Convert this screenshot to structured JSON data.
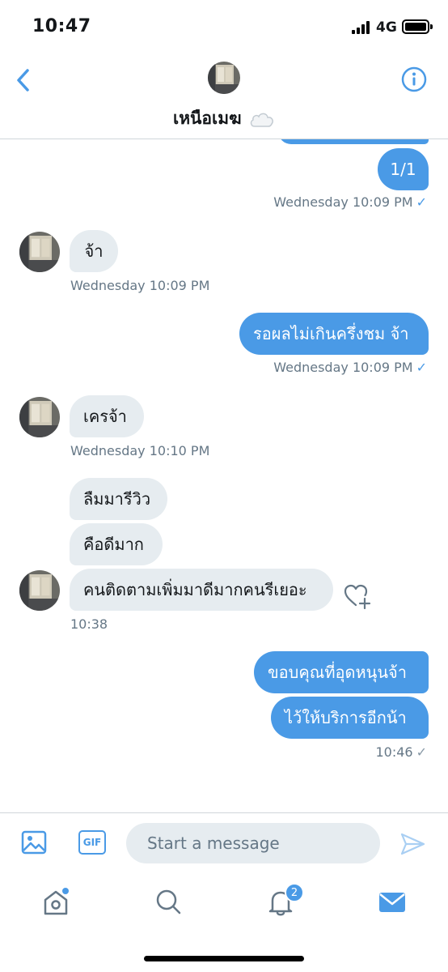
{
  "status_bar": {
    "time": "10:47",
    "network": "4G"
  },
  "header": {
    "contact_name": "เหนือเมฆ",
    "back_icon": "chevron-left-icon",
    "info_icon": "info-icon"
  },
  "messages": [
    {
      "id": "m0",
      "direction": "outgoing",
      "text": ""
    },
    {
      "id": "m1",
      "direction": "outgoing",
      "text": "1/1",
      "meta": "Wednesday 10:09 PM",
      "read": true
    },
    {
      "id": "m2",
      "direction": "incoming",
      "text": "จ้า",
      "meta": "Wednesday 10:09 PM"
    },
    {
      "id": "m3",
      "direction": "outgoing",
      "text": "รอผลไม่เกินครึ่งชม จ้า",
      "meta": "Wednesday 10:09 PM",
      "read": true
    },
    {
      "id": "m4",
      "direction": "incoming",
      "text": "เครจ้า",
      "meta": "Wednesday 10:10 PM"
    },
    {
      "id": "m5",
      "direction": "incoming",
      "text": "ลืมมารีวิว"
    },
    {
      "id": "m6",
      "direction": "incoming",
      "text": "คือดีมาก"
    },
    {
      "id": "m7",
      "direction": "incoming",
      "text": "คนติดตามเพิ่มมาดีมากคนรีเยอะ",
      "meta": "10:38",
      "reaction_icon": "heart-add-icon"
    },
    {
      "id": "m8",
      "direction": "outgoing",
      "text": "ขอบคุณที่อุดหนุนจ้า"
    },
    {
      "id": "m9",
      "direction": "outgoing",
      "text": "ไว้ให้บริการอีกน้า",
      "meta": "10:46",
      "read": false
    }
  ],
  "composer": {
    "placeholder": "Start a message",
    "gif_label": "GIF"
  },
  "tabbar": {
    "notifications_count": "2"
  },
  "colors": {
    "accent": "#4a9ae6",
    "incoming_bubble": "#e6ecf0",
    "meta_text": "#657786"
  }
}
